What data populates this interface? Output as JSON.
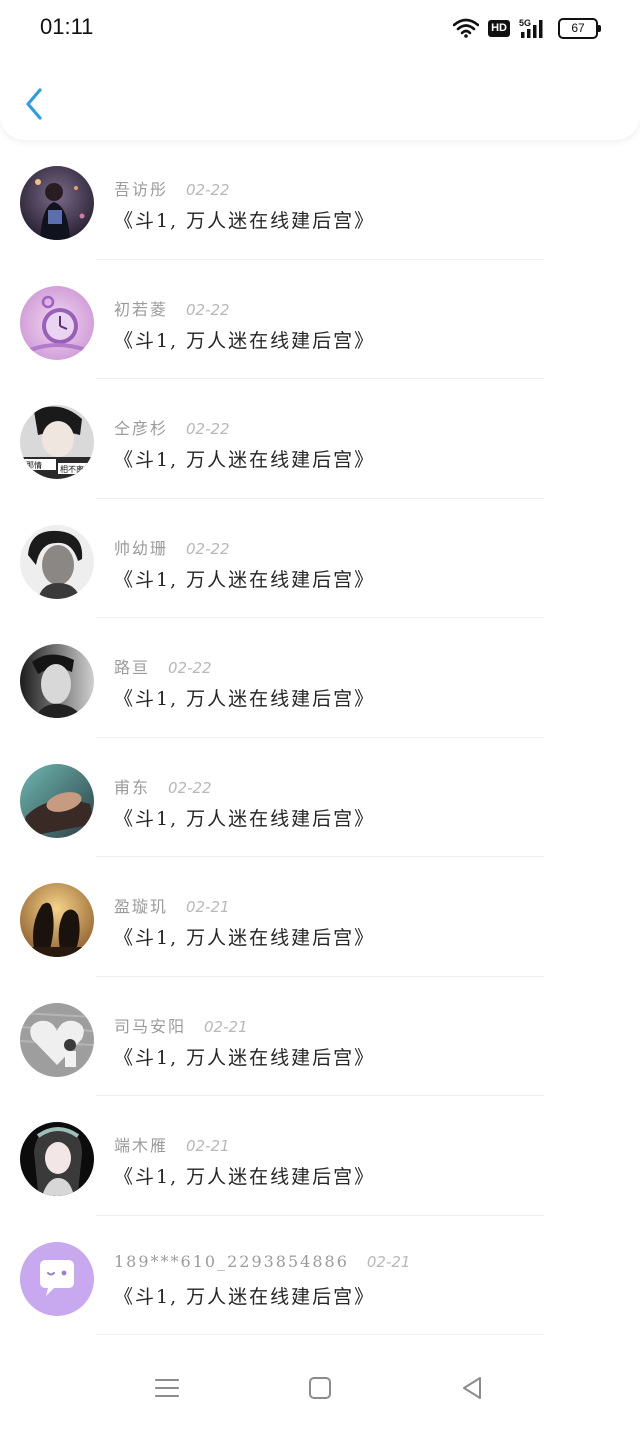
{
  "status_bar": {
    "time": "01:11",
    "network_badge": "HD",
    "signal_label": "5G",
    "battery_level": "67"
  },
  "header": {
    "back_icon": "chevron-left-icon",
    "accent_color": "#2a9ee8"
  },
  "messages": [
    {
      "name": "吾访彤",
      "date": "02-22",
      "text": "《斗1, 万人迷在线建后宫》",
      "avatar": "photo-girl-night"
    },
    {
      "name": "初若菱",
      "date": "02-22",
      "text": "《斗1, 万人迷在线建后宫》",
      "avatar": "pocket-watch-purple"
    },
    {
      "name": "仝彦杉",
      "date": "02-22",
      "text": "《斗1, 万人迷在线建后宫》",
      "avatar": "photo-boy-caption"
    },
    {
      "name": "帅幼珊",
      "date": "02-22",
      "text": "《斗1, 万人迷在线建后宫》",
      "avatar": "photo-portrait-bw"
    },
    {
      "name": "路亘",
      "date": "02-22",
      "text": "《斗1, 万人迷在线建后宫》",
      "avatar": "photo-man-bw"
    },
    {
      "name": "甫东",
      "date": "02-22",
      "text": "《斗1, 万人迷在线建后宫》",
      "avatar": "photo-face-teal"
    },
    {
      "name": "盈璇玑",
      "date": "02-21",
      "text": "《斗1, 万人迷在线建后宫》",
      "avatar": "penguins-sunset"
    },
    {
      "name": "司马安阳",
      "date": "02-21",
      "text": "《斗1, 万人迷在线建后宫》",
      "avatar": "photo-wall-heart"
    },
    {
      "name": "端木雁",
      "date": "02-21",
      "text": "《斗1, 万人迷在线建后宫》",
      "avatar": "anime-girl"
    },
    {
      "name": "189***610_2293854886",
      "date": "02-21",
      "text": "《斗1, 万人迷在线建后宫》",
      "avatar": "default-chat-bubble"
    }
  ],
  "avatar_1_caption_left": "那情",
  "avatar_1_caption_right": "相不离",
  "nav": {
    "menu_icon": "menu-icon",
    "home_icon": "home-square-icon",
    "back_icon": "back-triangle-icon"
  }
}
